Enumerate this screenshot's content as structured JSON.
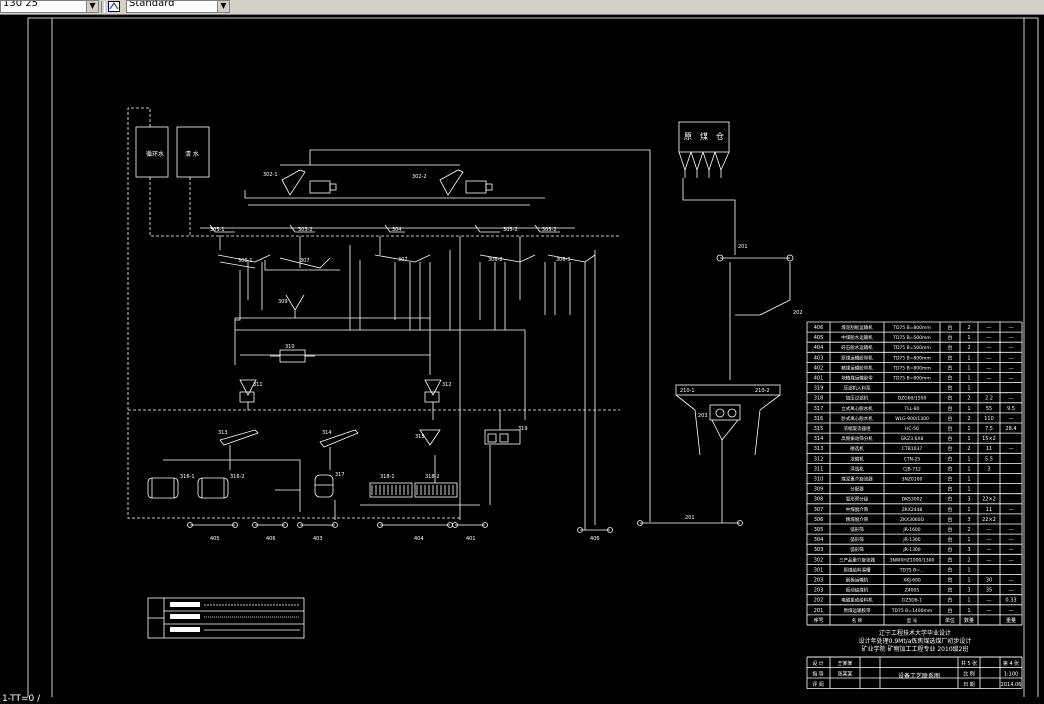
{
  "toolbar": {
    "scale_value": "130 25",
    "text_style_value": "Standard"
  },
  "drawing": {
    "top_boxes": {
      "left": "循环水",
      "right": "清 水"
    },
    "raw_coal_bins": [
      "原",
      "煤",
      "仓"
    ],
    "labels": {
      "302_1": "302-1",
      "302_2": "302-2",
      "305_1": "305-1",
      "305_2": "305-2",
      "304": "304",
      "306": "306",
      "307": "307",
      "309": "309",
      "310": "310",
      "311": "311",
      "312": "312",
      "313": "313",
      "314": "314",
      "315": "315",
      "317": "317",
      "316_1": "316-1",
      "316_2": "316-2",
      "318_1": "318-1",
      "318_2": "318-2",
      "319": "319",
      "401": "401",
      "402": "402",
      "403": "403",
      "404": "404",
      "405": "405",
      "406": "406",
      "201": "201",
      "202": "202",
      "203": "203",
      "204": "204",
      "210_1": "210-1",
      "210_2": "210-2",
      "301": "301"
    },
    "bill": {
      "rows": [
        [
          "406",
          "煤泥刮板运输机",
          "TD75 B=800mm",
          "台",
          "2",
          "—",
          "—"
        ],
        [
          "405",
          "中煤脱水运输机",
          "TD75 B=500mm",
          "台",
          "1",
          "—",
          "—"
        ],
        [
          "404",
          "矸石脱水运输机",
          "TD75 B=500mm",
          "台",
          "2",
          "—",
          "—"
        ],
        [
          "403",
          "原煤运输胶带机",
          "TD75 B=800mm",
          "台",
          "1",
          "—",
          "—"
        ],
        [
          "402",
          "精煤运输胶带机",
          "TD75 B=800mm",
          "台",
          "1",
          "—",
          "—"
        ],
        [
          "401",
          "块精煤运输胶带",
          "TD75 B=800mm",
          "台",
          "1",
          "—",
          "—"
        ],
        [
          "319",
          "压滤机入料泵",
          "",
          "台",
          "1",
          "",
          ""
        ],
        [
          "318",
          "加压过滤机",
          "DZG60/1500",
          "台",
          "2",
          "2.2",
          "—"
        ],
        [
          "317",
          "立式离心脱水机",
          "TLL-80",
          "台",
          "1",
          "55",
          "9.5"
        ],
        [
          "316",
          "卧式离心脱水机",
          "WLG-900/1300",
          "台",
          "2",
          "110",
          "—"
        ],
        [
          "315",
          "浓缩旋流器组",
          "HC-50",
          "台",
          "1",
          "7.5",
          "28.4"
        ],
        [
          "314",
          "高频振动筛分机",
          "GKZ3.6X8",
          "台",
          "1",
          "15×2",
          ""
        ],
        [
          "313",
          "磁选机",
          "CTB1037",
          "台",
          "2",
          "11",
          "—"
        ],
        [
          "312",
          "浓缩机",
          "CTN-25",
          "台",
          "1",
          "5.5",
          ""
        ],
        [
          "311",
          "浮选机",
          "CJB-712",
          "台",
          "1",
          "3",
          ""
        ],
        [
          "310",
          "煤泥重介旋流器",
          "3NZ0100",
          "台",
          "1",
          "",
          ""
        ],
        [
          "309",
          "分配器",
          "",
          "台",
          "1",
          "",
          ""
        ],
        [
          "308",
          "弧形筛分级",
          "DKS3002",
          "台",
          "3",
          "22×2",
          ""
        ],
        [
          "307",
          "中煤脱介筛",
          "ZKX2448",
          "台",
          "1",
          "11",
          "—"
        ],
        [
          "306",
          "精煤脱介筛",
          "ZKX3060D",
          "台",
          "3",
          "22×2",
          ""
        ],
        [
          "305",
          "弧形筛",
          "JR-1600",
          "台",
          "2",
          "—",
          "—"
        ],
        [
          "304",
          "弧形筛",
          "JR-1300",
          "台",
          "1",
          "—",
          "—"
        ],
        [
          "303",
          "弧形筛",
          "JR-1300",
          "台",
          "3",
          "—",
          "—"
        ],
        [
          "302",
          "三产品重介旋流器",
          "3NWXHZ1000/1300",
          "台",
          "2",
          "—",
          "—"
        ],
        [
          "301",
          "原煤给料溜槽",
          "TD75 B=...",
          "台",
          "1",
          "",
          ""
        ],
        [
          "203",
          "刮板运输机",
          "XKJ-600",
          "台",
          "1",
          "30",
          "—"
        ],
        [
          "203",
          "振动给煤机",
          "Z4005",
          "台",
          "3",
          "35",
          "—"
        ],
        [
          "202",
          "电磁振动给料机",
          "GZ5D6-1",
          "台",
          "1",
          "—",
          "0.33"
        ],
        [
          "201",
          "原煤运输胶带",
          "TD75 B=1400mm",
          "台",
          "1",
          "—",
          "—"
        ]
      ],
      "header": [
        "序号",
        "名 称",
        "型 号",
        "单位",
        "数量",
        "",
        "重量"
      ],
      "title_lines": [
        "辽宁工程技术大学毕业设计",
        "设计年处理0.9Mt/a炼焦煤选煤厂初步设计",
        "矿业学院 矿物加工工程专业 2010级2班"
      ],
      "designer_label": "设 计",
      "designer": "王某某",
      "checker_label": "指 导",
      "checker": "张某某",
      "review_label": "评 阅",
      "drawing_name": "设备工艺联系图",
      "sheets_total": "共 5 张",
      "sheet_no": "第 4 张",
      "scale_label": "比 例",
      "scale_value": "1:100",
      "date_label": "日 期",
      "date_value": "2014.06"
    },
    "bottom_labels": [
      "405",
      "406",
      "403",
      "404",
      "401",
      "406"
    ],
    "bus_label": "201",
    "chute_202": "202"
  },
  "statusbar": {
    "text": "1-TT=0 /"
  }
}
